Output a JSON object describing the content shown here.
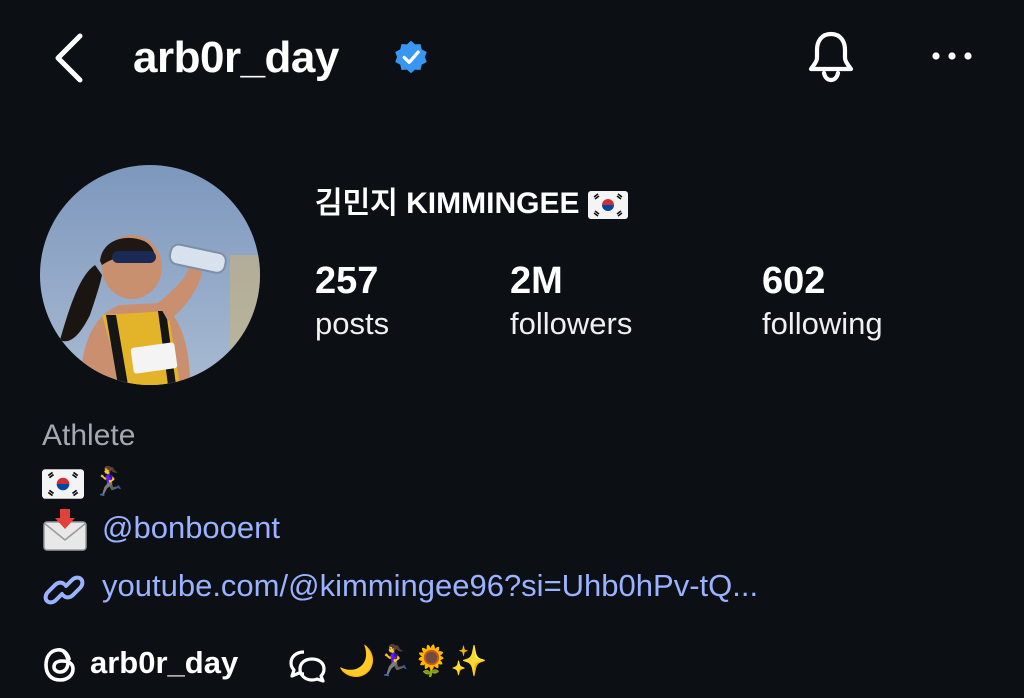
{
  "header": {
    "username": "arb0r_day",
    "icons": [
      "back-icon",
      "verified-badge-icon",
      "bell-icon",
      "more-icon"
    ]
  },
  "profile": {
    "display_name": "김민지 KIMMINGEE",
    "stats": [
      {
        "value": "257",
        "label": "posts"
      },
      {
        "value": "2M",
        "label": "followers"
      },
      {
        "value": "602",
        "label": "following"
      }
    ]
  },
  "bio": {
    "category": "Athlete",
    "emoji_line": "🏃‍♀️",
    "mention": "@bonbooent",
    "link": "youtube.com/@kimmingee96?si=Uhb0hPv-tQ..."
  },
  "threads": {
    "username": "arb0r_day",
    "emoji": "🌙🏃‍♀️🌻✨"
  },
  "colors": {
    "background": "#0c0f14",
    "link": "#9ab2ff",
    "verified": "#3897f0",
    "muted": "#a4a9b1"
  }
}
